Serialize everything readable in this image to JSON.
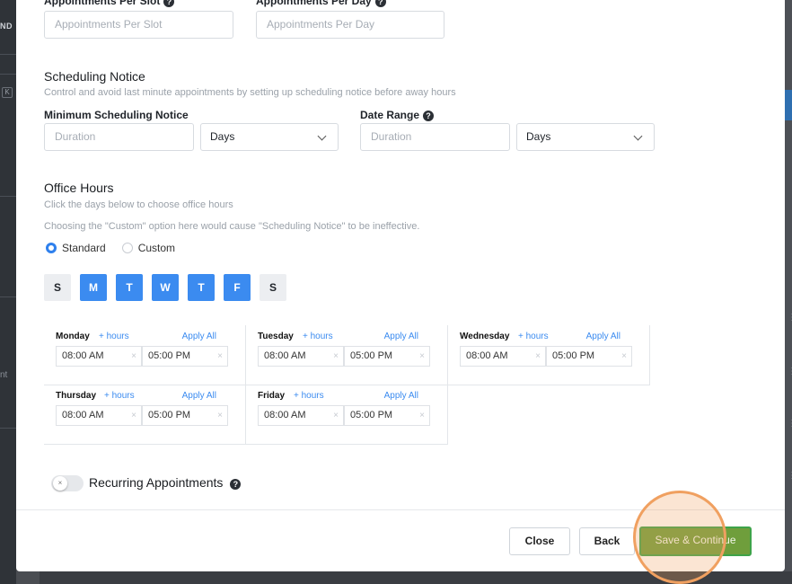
{
  "background": {
    "left_tag": "ND",
    "left_box": "K",
    "left_text": "nt"
  },
  "top_fields": {
    "slot": {
      "label": "Appointments Per Slot",
      "placeholder": "Appointments Per Slot"
    },
    "day": {
      "label": "Appointments Per Day",
      "placeholder": "Appointments Per Day"
    }
  },
  "scheduling": {
    "title": "Scheduling Notice",
    "description": "Control and avoid last minute appointments by setting up scheduling notice before away hours",
    "min_label": "Minimum Scheduling Notice",
    "min_placeholder": "Duration",
    "min_unit": "Days",
    "range_label": "Date Range",
    "range_placeholder": "Duration",
    "range_unit": "Days"
  },
  "office_hours": {
    "title": "Office Hours",
    "hint1": "Click the days below to choose office hours",
    "hint2": "Choosing the \"Custom\" option here would cause \"Scheduling Notice\" to be ineffective.",
    "options": [
      {
        "label": "Standard",
        "selected": true
      },
      {
        "label": "Custom",
        "selected": false
      }
    ],
    "days": [
      {
        "letter": "S",
        "active": false
      },
      {
        "letter": "M",
        "active": true
      },
      {
        "letter": "T",
        "active": true
      },
      {
        "letter": "W",
        "active": true
      },
      {
        "letter": "T",
        "active": true
      },
      {
        "letter": "F",
        "active": true
      },
      {
        "letter": "S",
        "active": false
      }
    ],
    "add_hours": "+ hours",
    "apply_all": "Apply All",
    "schedule": [
      {
        "day": "Monday",
        "start": "08:00 AM",
        "end": "05:00 PM"
      },
      {
        "day": "Tuesday",
        "start": "08:00 AM",
        "end": "05:00 PM"
      },
      {
        "day": "Wednesday",
        "start": "08:00 AM",
        "end": "05:00 PM"
      },
      {
        "day": "Thursday",
        "start": "08:00 AM",
        "end": "05:00 PM"
      },
      {
        "day": "Friday",
        "start": "08:00 AM",
        "end": "05:00 PM"
      }
    ]
  },
  "recurring": {
    "label": "Recurring Appointments",
    "enabled": false
  },
  "footer": {
    "close": "Close",
    "back": "Back",
    "save": "Save & Continue"
  },
  "colors": {
    "accent_blue": "#3b8bf0",
    "primary_green": "#6f9e3c",
    "highlight": "#f0a060"
  }
}
